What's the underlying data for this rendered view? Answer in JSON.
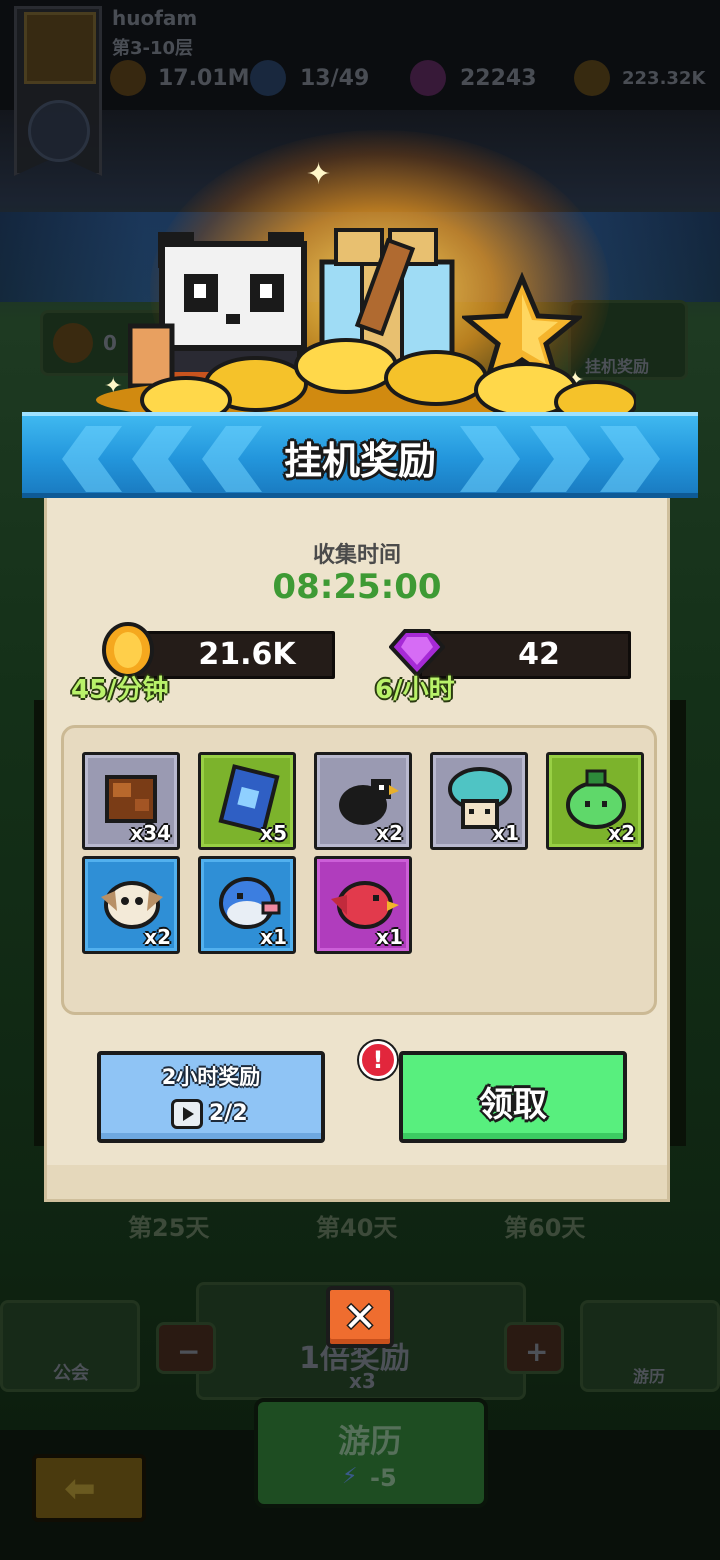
{
  "background": {
    "player_name": "huofam",
    "player_subtitle": "第3-10层",
    "power_value": "17.01M",
    "energy_value": "13/49",
    "gem_value": "22243",
    "gold_value": "223.32K",
    "left_counter": "0",
    "right_tile_label": "挂机奖励",
    "day_labels": [
      "第25天",
      "第40天",
      "第60天"
    ],
    "guild_label": "公会",
    "travel_label": "游历",
    "multiplier_label": "1倍奖励",
    "multiplier_cost": "x3",
    "go_button_label": "游历",
    "go_button_cost": "-5",
    "minus_label": "−",
    "plus_label": "+"
  },
  "dialog": {
    "title": "挂机奖励",
    "collect_label": "收集时间",
    "collect_time": "08:25:00",
    "gold": {
      "value": "21.6K",
      "rate": "45/分钟",
      "icon": "gold-coin-icon"
    },
    "gems": {
      "value": "42",
      "rate": "6/小时",
      "icon": "purple-gem-icon"
    },
    "items": [
      {
        "name": "wood-chunk-icon",
        "qty": "x34",
        "rarity": "gray"
      },
      {
        "name": "blue-card-icon",
        "qty": "x5",
        "rarity": "green"
      },
      {
        "name": "black-crow-icon",
        "qty": "x2",
        "rarity": "gray"
      },
      {
        "name": "teal-mushroom-icon",
        "qty": "x1",
        "rarity": "gray"
      },
      {
        "name": "green-slime-icon",
        "qty": "x2",
        "rarity": "green"
      },
      {
        "name": "owl-icon",
        "qty": "x2",
        "rarity": "blue"
      },
      {
        "name": "pufferfish-icon",
        "qty": "x1",
        "rarity": "blue"
      },
      {
        "name": "red-bird-icon",
        "qty": "x1",
        "rarity": "purple"
      }
    ],
    "bonus_button": {
      "title": "2小时奖励",
      "count": "2/2",
      "alert": "!"
    },
    "claim_button": {
      "label": "领取"
    },
    "close_label": "✕"
  },
  "colors": {
    "ribbon": "#2396dc",
    "panel": "#ede3cc",
    "time_green": "#3e9a34",
    "claim_green": "#58ef7e",
    "bonus_blue": "#8fc4f5",
    "close_orange": "#ef6d2f"
  }
}
